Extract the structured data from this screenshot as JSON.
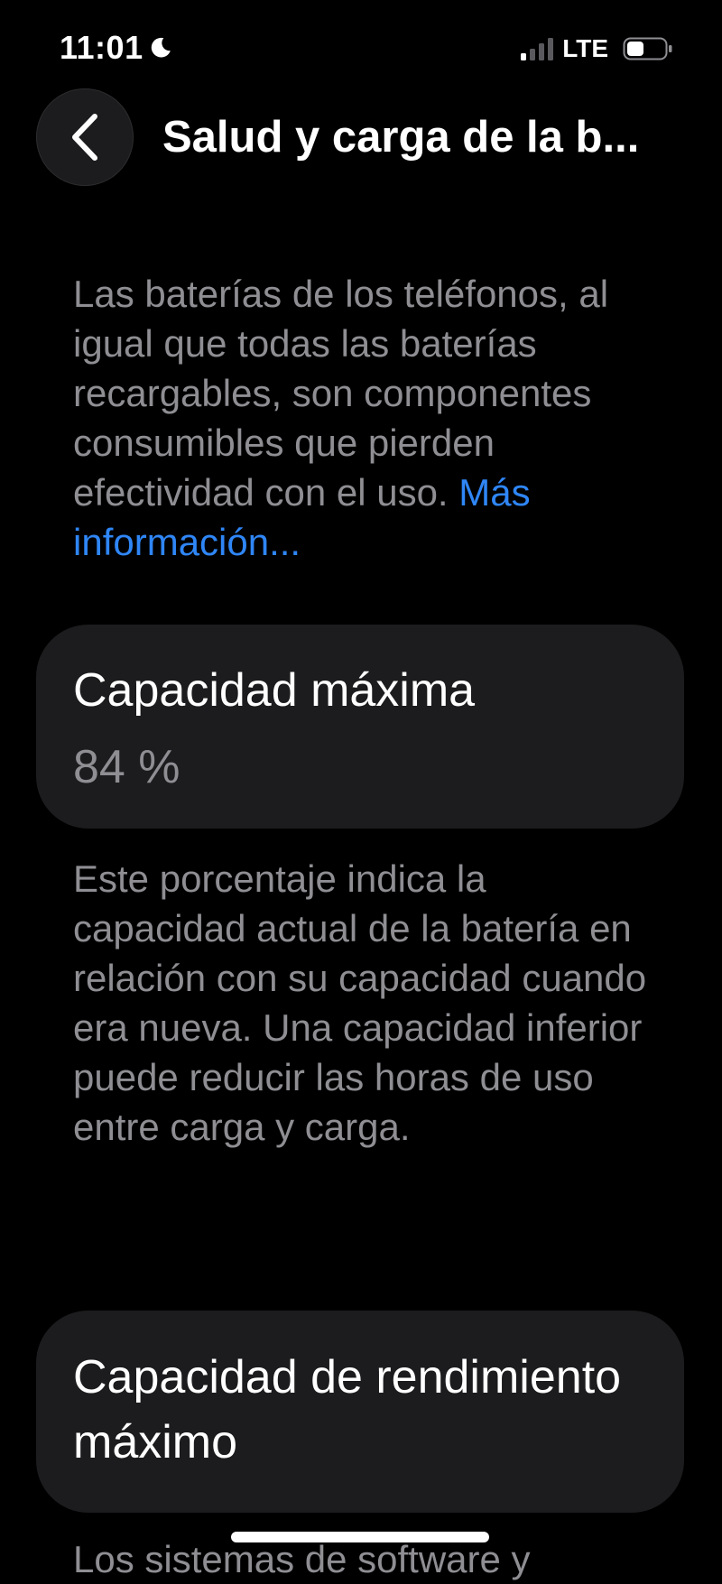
{
  "status_bar": {
    "time": "11:01",
    "network": "LTE",
    "icons": [
      "moon-icon",
      "signal-icon",
      "battery-icon"
    ]
  },
  "nav": {
    "back_icon": "chevron-left-icon",
    "title": "Salud y carga de la b..."
  },
  "intro": {
    "text": "Las baterías de los teléfonos, al igual que todas las baterías recargables, son componentes consumibles que pierden efectividad con el uso. ",
    "link": "Más información..."
  },
  "max_capacity": {
    "title": "Capacidad máxima",
    "value": "84 %",
    "description": "Este porcentaje indica la capacidad actual de la batería en relación con su capacidad cuando era nueva. Una capacidad inferior puede reducir las horas de uso entre carga y carga."
  },
  "peak_performance": {
    "title": "Capacidad de rendimiento máximo",
    "description_partial": "Los sistemas de software y"
  },
  "colors": {
    "background": "#000000",
    "card": "#1c1c1e",
    "secondary_text": "#8e8e93",
    "link": "#2f86f6"
  }
}
